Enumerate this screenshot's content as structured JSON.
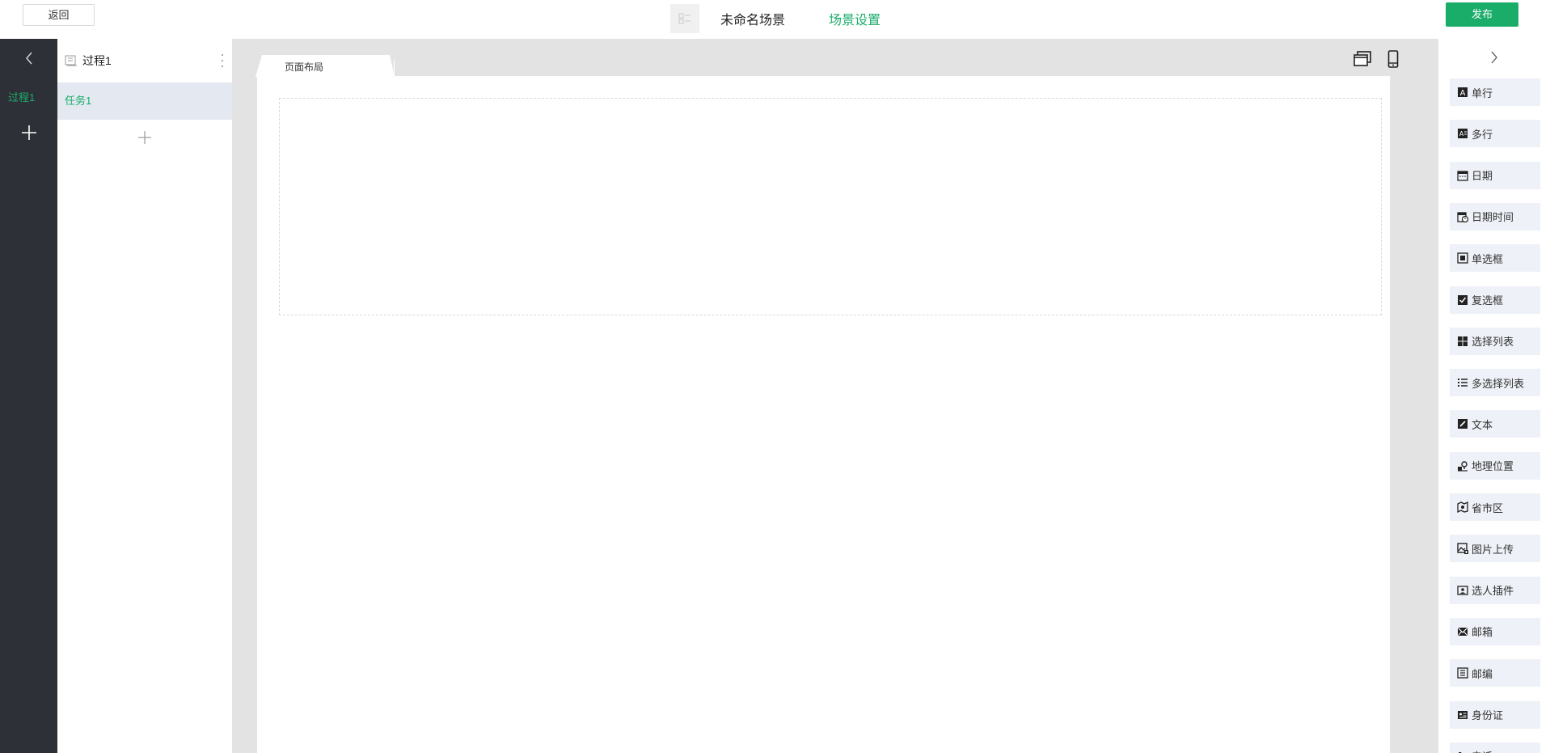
{
  "header": {
    "back_label": "返回",
    "scene_name": "未命名场景",
    "scene_settings_label": "场景设置",
    "publish_label": "发布"
  },
  "rail": {
    "process_item_label": "过程1"
  },
  "task_panel": {
    "process_title": "过程1",
    "task_item_label": "任务1"
  },
  "canvas": {
    "tab_label": "页面布局"
  },
  "components": {
    "items": [
      {
        "label": "单行",
        "icon": "single-line-text-icon"
      },
      {
        "label": "多行",
        "icon": "multi-line-text-icon"
      },
      {
        "label": "日期",
        "icon": "calendar-icon"
      },
      {
        "label": "日期时间",
        "icon": "calendar-clock-icon"
      },
      {
        "label": "单选框",
        "icon": "radio-icon"
      },
      {
        "label": "复选框",
        "icon": "checkbox-icon"
      },
      {
        "label": "选择列表",
        "icon": "grid-icon"
      },
      {
        "label": "多选择列表",
        "icon": "list-icon"
      },
      {
        "label": "文本",
        "icon": "pencil-icon"
      },
      {
        "label": "地理位置",
        "icon": "location-icon"
      },
      {
        "label": "省市区",
        "icon": "map-icon"
      },
      {
        "label": "图片上传",
        "icon": "image-upload-icon"
      },
      {
        "label": "选人插件",
        "icon": "person-picker-icon"
      },
      {
        "label": "邮箱",
        "icon": "mail-icon"
      },
      {
        "label": "邮编",
        "icon": "postcode-icon"
      },
      {
        "label": "身份证",
        "icon": "id-card-icon"
      },
      {
        "label": "电话",
        "icon": "phone-icon"
      }
    ]
  }
}
